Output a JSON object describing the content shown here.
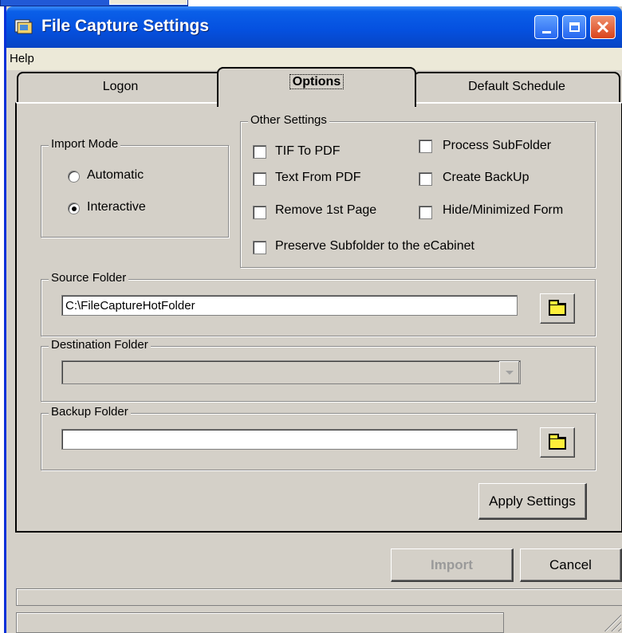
{
  "window": {
    "title": "File Capture Settings"
  },
  "menu": {
    "items": [
      "Help"
    ]
  },
  "tabs": [
    {
      "label": "Logon",
      "selected": false
    },
    {
      "label": "Options",
      "selected": true
    },
    {
      "label": "Default Schedule",
      "selected": false
    }
  ],
  "import_mode": {
    "legend": "Import Mode",
    "options": [
      {
        "label": "Automatic",
        "checked": false
      },
      {
        "label": "Interactive",
        "checked": true
      }
    ]
  },
  "other_settings": {
    "legend": "Other Settings",
    "checkboxes": [
      {
        "label": "TIF To PDF",
        "checked": false
      },
      {
        "label": "Process SubFolder",
        "checked": false
      },
      {
        "label": "Text From PDF",
        "checked": false
      },
      {
        "label": "Create BackUp",
        "checked": false
      },
      {
        "label": "Remove 1st Page",
        "checked": false
      },
      {
        "label": "Hide/Minimized Form",
        "checked": false
      },
      {
        "label": "Preserve Subfolder to the eCabinet",
        "checked": false
      }
    ]
  },
  "source_folder": {
    "legend": "Source Folder",
    "value": "C:\\FileCaptureHotFolder"
  },
  "destination_folder": {
    "legend": "Destination Folder",
    "value": ""
  },
  "backup_folder": {
    "legend": "Backup Folder",
    "value": ""
  },
  "buttons": {
    "apply": "Apply Settings",
    "import": "Import",
    "cancel": "Cancel"
  },
  "colors": {
    "titlebar": "#0551e0",
    "close_button": "#d9431b",
    "face": "#d4d0c8",
    "folder": "#ffef3a"
  }
}
